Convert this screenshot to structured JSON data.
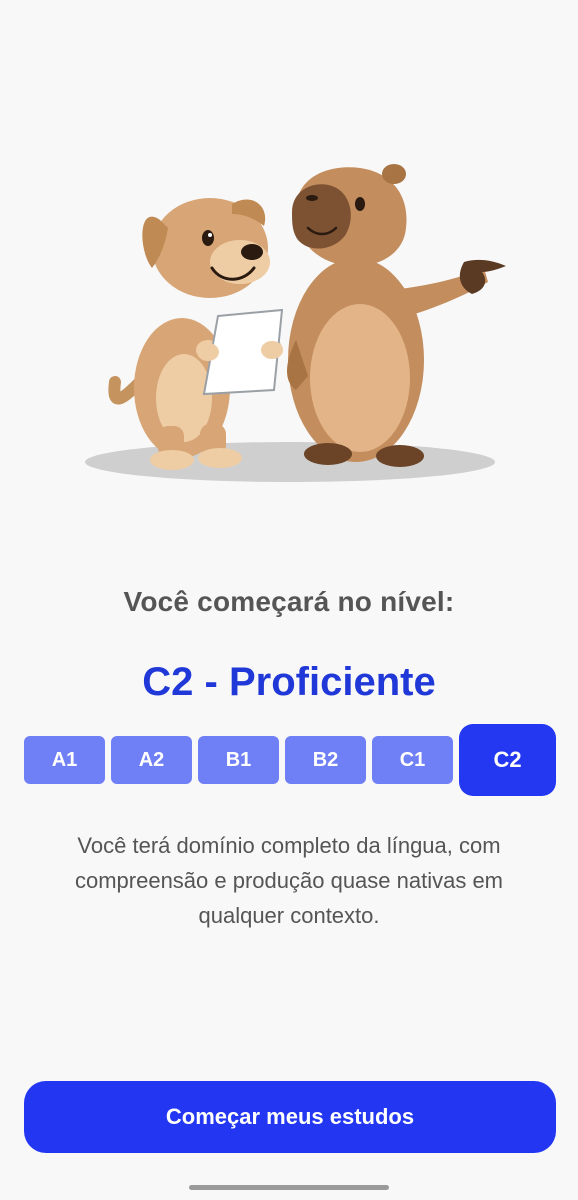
{
  "header": {
    "subtitle": "Você começará no nível:",
    "level_title": "C2 - Proficiente"
  },
  "levels": {
    "items": [
      "A1",
      "A2",
      "B1",
      "B2",
      "C1",
      "C2"
    ],
    "selected": "C2"
  },
  "description": "Você terá domínio completo da língua, com compreensão e produção quase nativas em qualquer contexto.",
  "actions": {
    "start_label": "Começar meus estudos"
  },
  "colors": {
    "accent": "#2337f3",
    "level_inactive": "#6f7ff5",
    "title_blue": "#2038d8",
    "text_gray": "#555555",
    "background": "#f8f8f8"
  }
}
